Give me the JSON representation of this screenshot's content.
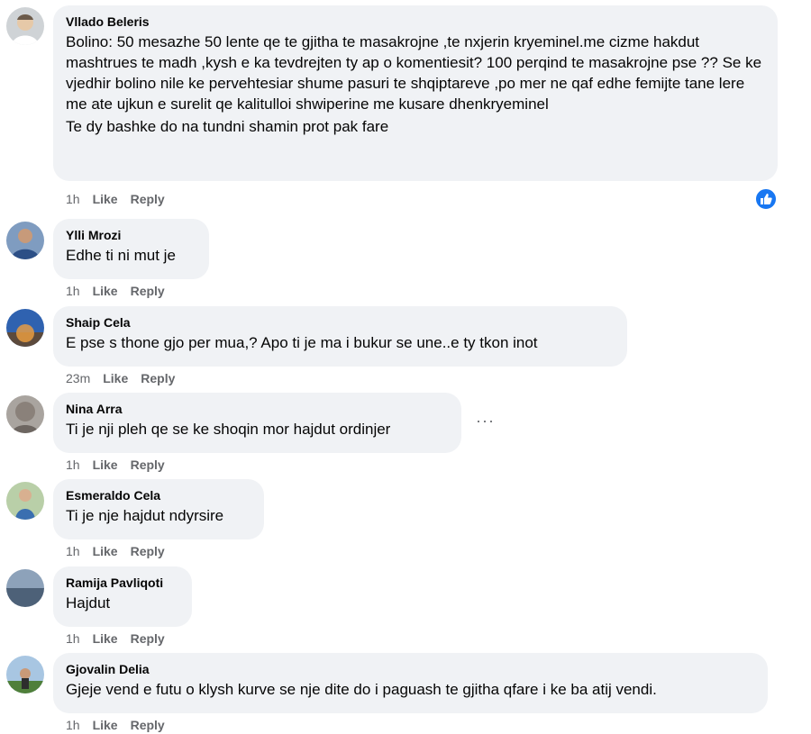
{
  "comments": [
    {
      "author": "Vllado Beleris",
      "text": "Bolino: 50 mesazhe 50 lente qe te gjitha te masakrojne ,te nxjerin kryeminel.me cizme hakdut mashtrues te madh ,kysh e ka tevdrejten ty ap o komentiesit? 100 perqind te masakrojne pse ?? Se ke vjedhir bolino nile ke pervehtesiar shume pasuri te shqiptareve ,po mer ne qaf edhe femijte tane lere me ate ujkun e surelit qe kalitulloi shwiperine me kusare dhenkryeminel",
      "text2": "Te dy bashke do na tundni shamin prot pak fare",
      "time": "1h",
      "like": "Like",
      "reply": "Reply",
      "avatar_color": "#b9b2a5"
    },
    {
      "author": "Ylli Mrozi",
      "text": "Edhe ti ni mut je",
      "time": "1h",
      "like": "Like",
      "reply": "Reply",
      "avatar_color": "#3a5a8a"
    },
    {
      "author": "Shaip Cela",
      "text": "E pse s thone gjo per mua,? Apo ti je ma i bukur se une..e ty tkon inot",
      "time": "23m",
      "like": "Like",
      "reply": "Reply",
      "avatar_color": "#2f5fa6"
    },
    {
      "author": "Nina Arra",
      "text": "Ti je nji pleh qe se ke shoqin mor hajdut ordinjer",
      "time": "1h",
      "like": "Like",
      "reply": "Reply",
      "avatar_color": "#8f8a86"
    },
    {
      "author": "Esmeraldo Cela",
      "text": "Ti je nje hajdut ndyrsire",
      "time": "1h",
      "like": "Like",
      "reply": "Reply",
      "avatar_color": "#7a9a6a"
    },
    {
      "author": "Ramija Pavliqoti",
      "text": "Hajdut",
      "time": "1h",
      "like": "Like",
      "reply": "Reply",
      "avatar_color": "#5b6f86"
    },
    {
      "author": "Gjovalin Delia",
      "text": "Gjeje vend e futu o klysh kurve se nje dite do i paguash te gjitha qfare i ke ba atij vendi.",
      "time": "1h",
      "like": "Like",
      "reply": "Reply",
      "avatar_color": "#5f8a4a"
    }
  ],
  "more_options": "···",
  "reaction_icon": "like-reaction-icon",
  "accent_color": "#1877f2"
}
